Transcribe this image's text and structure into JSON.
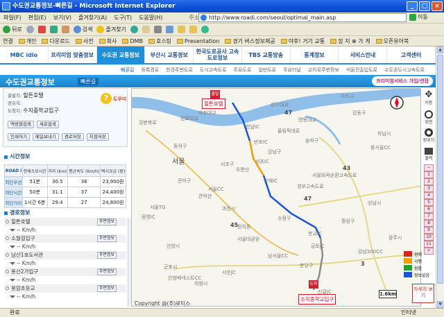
{
  "window": {
    "title": "수도권교통정보-빠른길 - Microsoft Internet Explorer",
    "btn_min": "_",
    "btn_max": "□",
    "btn_close": "×"
  },
  "menu": {
    "items": [
      "파일(F)",
      "편집(E)",
      "보기(V)",
      "즐겨찾기(A)",
      "도구(T)",
      "도움말(H)"
    ],
    "address_label": "주소(D)",
    "url": "http://www.roadi.com/seoul/optimal_main.asp",
    "go": "이동"
  },
  "toolbar": {
    "back": "뒤로",
    "search": "검색",
    "favorites": "즐겨찾기"
  },
  "links": {
    "label": "연결",
    "items": [
      "개인",
      "다운로드",
      "사전",
      "회사",
      "DMB",
      "호스팅",
      "Presentation",
      "경기 버스정보제공",
      "야후! 거기 교통",
      "잡 지 ⊕ 가 게",
      "오픈유어북"
    ]
  },
  "site": {
    "nav": [
      {
        "label": "MBC ĭdio",
        "active": false
      },
      {
        "label": "프리미엄 맞춤정보",
        "active": false
      },
      {
        "label": "수도권 교통정보",
        "active": true
      },
      {
        "label": "부산시 교통정보",
        "active": false
      },
      {
        "label": "한국도로공사 고속도로정보",
        "active": false
      },
      {
        "label": "TBS 교통방송",
        "active": false
      },
      {
        "label": "통계정보",
        "active": false
      },
      {
        "label": "서비스안내",
        "active": false
      },
      {
        "label": "고객센터",
        "active": false
      }
    ],
    "subnav": [
      "빠른길",
      "등록경로",
      "한강주변도로",
      "도시고속도로",
      "주요도로",
      "일반도로",
      "주요터널",
      "교차로주변정보",
      "서울진출입도로",
      "수도권도시고속도로"
    ],
    "section_title": "수도권교통정보",
    "section_sub": "빠른길",
    "premium": "프리미엄서비스 가입/연장"
  },
  "route": {
    "origin_label": "출발지:",
    "origin": "힐튼호텔",
    "via_label": "경유지:",
    "via": "",
    "dest_label": "도착지:",
    "dest": "수지중학교입구",
    "help": "?",
    "help_label": "도우미",
    "buttons1": [
      "역방향검색",
      "새로검색"
    ],
    "buttons2": [
      "인쇄하기",
      "메일보내기",
      "경로저장",
      "지점저장"
    ]
  },
  "time_info": {
    "title": "시간정보",
    "logo": "ROAD i",
    "headers": [
      "현재소요시간",
      "거리 (Km)",
      "평균속도 (Km/h)",
      "택시요금 (원)"
    ],
    "rows": [
      {
        "label": "최단우선",
        "time": "51분",
        "dist": "30.5",
        "speed": "36",
        "fare": "23,900원"
      },
      {
        "label": "최단시간",
        "time": "50분",
        "dist": "31.1",
        "speed": "37",
        "fare": "24,400원"
      },
      {
        "label": "최단거리",
        "time": "1시간 6분",
        "dist": "29.4",
        "speed": "27",
        "fare": "24,800원"
      }
    ]
  },
  "route_info": {
    "title": "경로정보",
    "info_btn": "주변정보",
    "speed": "-- Km/h",
    "items": [
      "힐튼호텔",
      "소월길입구",
      "남산1호도서관",
      "용산2가입구",
      "용암초등교"
    ]
  },
  "map": {
    "labels": [
      "서울",
      "동작구",
      "관악구",
      "서초구",
      "강남구",
      "송파구",
      "강동구",
      "과천시",
      "성남시",
      "중원구",
      "수정구",
      "분당구",
      "광주시",
      "구리시",
      "하남시",
      "안양시",
      "군포시",
      "의왕시",
      "남서울CC",
      "동서울CC",
      "서울CC",
      "강남300CC",
      "관악산",
      "안양베네스트CC",
      "서울대공원",
      "우면산",
      "경부고속도로",
      "서울외곽순환고속도로",
      "강변북로",
      "올림픽대로",
      "원지동",
      "판교IC",
      "양재IC",
      "서초IC",
      "반포IC",
      "한남IC",
      "광명IC",
      "서울TG",
      "서운JC",
      "금토JC",
      "신갈JC",
      "원효대교",
      "마포대교",
      "영동대교",
      "성수대교"
    ],
    "route_numbers": [
      "47",
      "43",
      "47",
      "3",
      "45"
    ],
    "origin_marker": "힐튼호텔",
    "dest_marker": "수지중학교입구",
    "start_pin": "출발",
    "end_pin": "도착",
    "copyright": "Copyright @(주)로티스",
    "scale": "1.6km"
  },
  "controls": {
    "move": "이동",
    "rotate": "회전",
    "original": "원위치",
    "print": "출력",
    "zoom": [
      "1",
      "2",
      "3",
      "4",
      "5",
      "6",
      "7",
      "8",
      "9",
      "10",
      "11"
    ],
    "zoom_plus": "+",
    "zoom_minus": "−",
    "legend": [
      {
        "label": "정체",
        "color": "#e02020"
      },
      {
        "label": "서행",
        "color": "#f2a000"
      },
      {
        "label": "원활",
        "color": "#22a030"
      },
      {
        "label": "정보없음",
        "color": "#1a55d8"
      }
    ],
    "expand": "자세히 보기"
  },
  "status": {
    "text": "완료",
    "zone": "인터넷"
  }
}
